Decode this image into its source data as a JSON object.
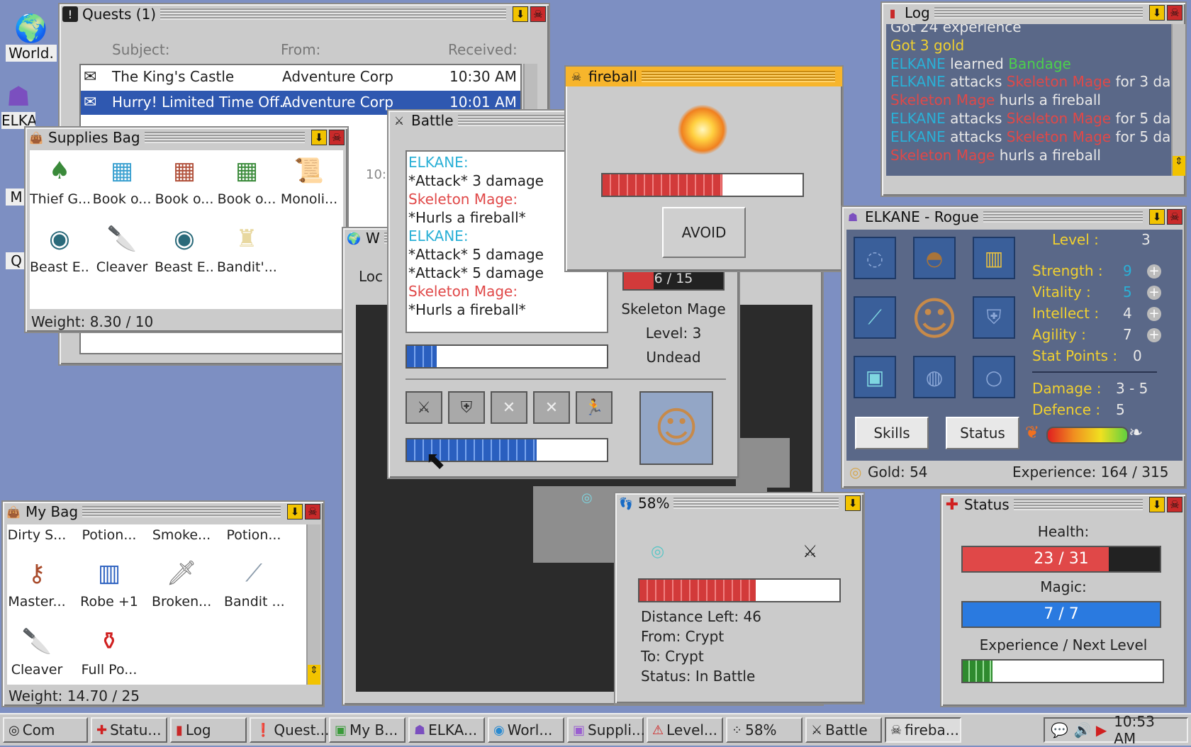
{
  "desktop": {
    "icons": [
      {
        "label": "World.",
        "icon": "globe-icon"
      },
      {
        "label": "ELKA",
        "icon": "rogue-icon"
      },
      {
        "label": "M",
        "icon": "bag-icon"
      },
      {
        "label": "Q",
        "icon": "quest-icon"
      },
      {
        "label": "",
        "icon": "map-icon"
      }
    ]
  },
  "quests": {
    "title": "Quests (1)",
    "headers": {
      "subject": "Subject:",
      "from": "From:",
      "received": "Received:"
    },
    "rows": [
      {
        "subject": "The King's Castle",
        "from": "Adventure Corp",
        "received": "10:30 AM",
        "selected": false
      },
      {
        "subject": "Hurry! Limited Time Off...",
        "from": "Adventure Corp",
        "received": "10:01 AM",
        "selected": true
      }
    ],
    "partial": "10:01"
  },
  "supplies": {
    "title": "Supplies Bag",
    "items": [
      {
        "label": "Thief G...",
        "icon": "hood-icon"
      },
      {
        "label": "Book o...",
        "icon": "book-blue-icon"
      },
      {
        "label": "Book o...",
        "icon": "book-red-icon"
      },
      {
        "label": "Book o...",
        "icon": "book-green-icon"
      },
      {
        "label": "Monoli...",
        "icon": "scroll-icon"
      },
      {
        "label": "Beast E...",
        "icon": "beast-eye-icon"
      },
      {
        "label": "Cleaver",
        "icon": "cleaver-icon"
      },
      {
        "label": "Beast E...",
        "icon": "beast-eye-icon"
      },
      {
        "label": "Bandit'...",
        "icon": "tooth-icon"
      }
    ],
    "weight": "Weight: 8.30 / 10"
  },
  "battle": {
    "title": "Battle",
    "log": [
      {
        "text": "ELKANE:",
        "color": "cyan"
      },
      {
        "text": "*Attack* 3 damage",
        "color": "normal"
      },
      {
        "text": "Skeleton Mage:",
        "color": "red"
      },
      {
        "text": "*Hurls a fireball*",
        "color": "normal"
      },
      {
        "text": "ELKANE:",
        "color": "cyan"
      },
      {
        "text": "*Attack* 5 damage",
        "color": "normal"
      },
      {
        "text": "*Attack* 5 damage",
        "color": "normal"
      },
      {
        "text": "Skeleton Mage:",
        "color": "red"
      },
      {
        "text": "*Hurls a fireball*",
        "color": "normal"
      }
    ],
    "player_bar_fraction": 0.15,
    "action_bar_fraction": 0.65,
    "enemy_hp": "6 / 15",
    "enemy_hp_fraction": 0.3,
    "enemy_name": "Skeleton Mage",
    "enemy_level": "Level: 3",
    "enemy_type": "Undead",
    "actions": [
      "sword-icon",
      "shield-icon",
      "x-icon",
      "x-icon",
      "run-icon"
    ]
  },
  "fireball": {
    "title": "fireball",
    "bar_fraction": 0.6,
    "avoid_label": "AVOID"
  },
  "world": {
    "title": "W",
    "loc_label": "Loc"
  },
  "log": {
    "title": "Log",
    "lines": [
      [
        {
          "t": "Got 24 experience",
          "c": "normal"
        }
      ],
      [
        {
          "t": "Got 3 gold",
          "c": "yellow"
        }
      ],
      [
        {
          "t": "ELKANE",
          "c": "cyan"
        },
        {
          "t": " learned ",
          "c": "normal"
        },
        {
          "t": "Bandage",
          "c": "green"
        }
      ],
      [
        {
          "t": "ELKANE",
          "c": "cyan"
        },
        {
          "t": " attacks ",
          "c": "normal"
        },
        {
          "t": "Skeleton Mage",
          "c": "red"
        },
        {
          "t": " for 3 dam",
          "c": "normal"
        }
      ],
      [
        {
          "t": "Skeleton Mage",
          "c": "red"
        },
        {
          "t": " hurls a fireball",
          "c": "normal"
        }
      ],
      [
        {
          "t": "ELKANE",
          "c": "cyan"
        },
        {
          "t": " attacks ",
          "c": "normal"
        },
        {
          "t": "Skeleton Mage",
          "c": "red"
        },
        {
          "t": " for 5 dam",
          "c": "normal"
        }
      ],
      [
        {
          "t": "ELKANE",
          "c": "cyan"
        },
        {
          "t": " attacks ",
          "c": "normal"
        },
        {
          "t": "Skeleton Mage",
          "c": "red"
        },
        {
          "t": " for 5 dam",
          "c": "normal"
        }
      ],
      [
        {
          "t": "Skeleton Mage",
          "c": "red"
        },
        {
          "t": " hurls a fireball",
          "c": "normal"
        }
      ]
    ]
  },
  "character": {
    "title": "ELKANE - Rogue",
    "level_label": "Level :",
    "level": "3",
    "stats": [
      {
        "label": "Strength :",
        "value": "9",
        "hl": true
      },
      {
        "label": "Vitality :",
        "value": "5",
        "hl": true
      },
      {
        "label": "Intellect :",
        "value": "4",
        "hl": false
      },
      {
        "label": "Agility :",
        "value": "7",
        "hl": false
      }
    ],
    "stat_points_label": "Stat Points :",
    "stat_points": "0",
    "damage_label": "Damage :",
    "damage": "3 - 5",
    "defence_label": "Defence :",
    "defence": "5",
    "skills_label": "Skills",
    "status_label": "Status",
    "gold": "Gold: 54",
    "experience": "Experience: 164 / 315"
  },
  "travel": {
    "title": "58%",
    "bar_fraction": 0.58,
    "distance": "Distance Left:  46",
    "from": "From:  Crypt",
    "to": "To:  Crypt",
    "status": "Status:  In Battle"
  },
  "status": {
    "title": "Status",
    "health_label": "Health:",
    "health": "23 / 31",
    "health_fraction": 0.742,
    "magic_label": "Magic:",
    "magic": "7 / 7",
    "magic_fraction": 1.0,
    "exp_label": "Experience / Next Level",
    "exp_fraction": 0.15
  },
  "mybag": {
    "title": "My Bag",
    "items": [
      {
        "label": "Dirty S...",
        "icon": ""
      },
      {
        "label": "Potion...",
        "icon": ""
      },
      {
        "label": "Smoke...",
        "icon": ""
      },
      {
        "label": "Potion...",
        "icon": ""
      },
      {
        "label": "Master...",
        "icon": "key-icon"
      },
      {
        "label": "Robe +1",
        "icon": "robe-icon"
      },
      {
        "label": "Broken...",
        "icon": "dagger-icon"
      },
      {
        "label": "Bandit ...",
        "icon": "knife-icon"
      },
      {
        "label": "Cleaver",
        "icon": "cleaver-icon"
      },
      {
        "label": "Full Po...",
        "icon": "potion-icon"
      }
    ],
    "weight": "Weight: 14.70 / 25"
  },
  "taskbar": {
    "items": [
      {
        "label": "Com",
        "icon": "compass-icon"
      },
      {
        "label": "Statu...",
        "icon": "cross-icon"
      },
      {
        "label": "Log",
        "icon": "book-icon"
      },
      {
        "label": "Quest...",
        "icon": "quest-icon"
      },
      {
        "label": "My B...",
        "icon": "bag-icon"
      },
      {
        "label": "ELKA...",
        "icon": "rogue-icon"
      },
      {
        "label": "Worl...",
        "icon": "globe-icon"
      },
      {
        "label": "Suppli...",
        "icon": "bag-icon"
      },
      {
        "label": "Level...",
        "icon": "warning-icon"
      },
      {
        "label": "58%",
        "icon": "footsteps-icon"
      },
      {
        "label": "Battle",
        "icon": "swords-icon"
      },
      {
        "label": "fireba...",
        "icon": "skull-icon"
      }
    ],
    "clock": "10:53 AM"
  }
}
